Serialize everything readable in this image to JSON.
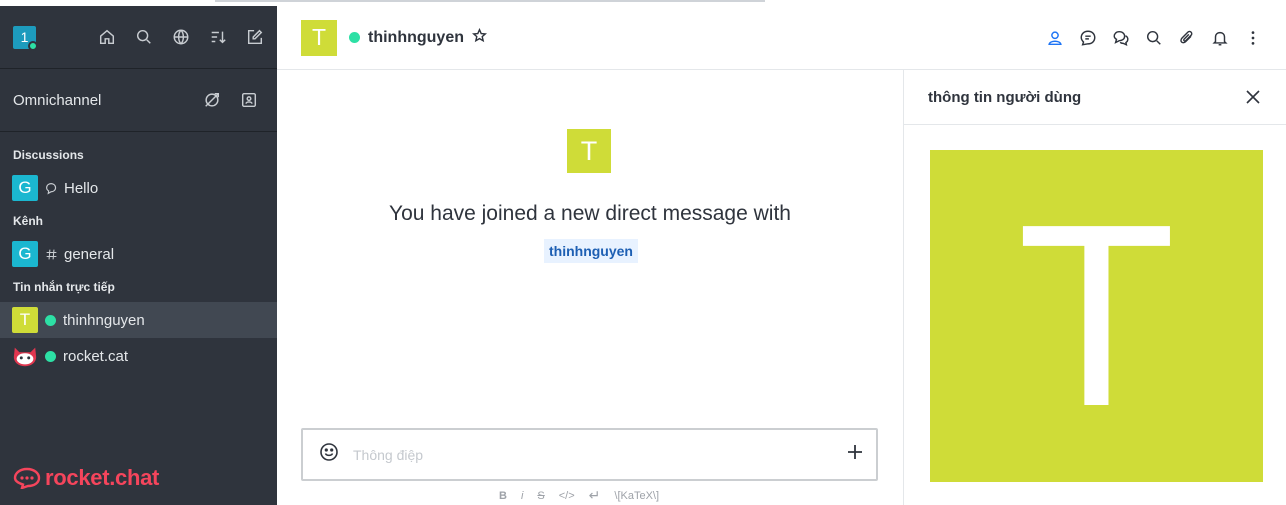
{
  "sidebar": {
    "user_avatar": "1",
    "icons": [
      "home-icon",
      "search-icon",
      "globe-icon",
      "sort-icon",
      "edit-icon"
    ],
    "omnichannel": {
      "label": "Omnichannel",
      "icons": [
        "omnichannel-offline-icon",
        "contact-center-icon"
      ]
    },
    "sections": [
      {
        "title": "Discussions",
        "items": [
          {
            "avatar": "G",
            "icon": "discussion-icon",
            "label": "Hello"
          }
        ]
      },
      {
        "title": "Kênh",
        "items": [
          {
            "avatar": "G",
            "icon": "hash-icon",
            "label": "general"
          }
        ]
      },
      {
        "title": "Tin nhắn trực tiếp",
        "items": [
          {
            "avatar": "T",
            "status": "online",
            "label": "thinhnguyen",
            "active": true
          },
          {
            "avatar": "rocket-cat",
            "status": "online",
            "label": "rocket.cat"
          }
        ]
      }
    ],
    "brand": "rocket.chat"
  },
  "header": {
    "avatar": "T",
    "name": "thinhnguyen",
    "status": "online",
    "icons": [
      "user-info-icon",
      "threads-icon",
      "discussions-icon",
      "search-icon",
      "attachment-icon",
      "notification-bell-icon",
      "kebab-menu-icon"
    ]
  },
  "main": {
    "avatar": "T",
    "welcome_text": "You have joined a new direct message with",
    "mention": "thinhnguyen",
    "composer": {
      "placeholder": "Thông điệp"
    },
    "format_bar": [
      "B",
      "i",
      "S",
      "</>",
      "↵",
      "\\[KaTeX\\]"
    ]
  },
  "panel": {
    "title": "thông tin người dùng",
    "avatar": "T"
  },
  "colors": {
    "sidebar_bg": "#2f343d",
    "avatar_lime": "#cfdc38",
    "avatar_teal": "#1bb7d0",
    "online": "#2de0a5",
    "brand": "#f5455c",
    "accent": "#1d74f5"
  }
}
